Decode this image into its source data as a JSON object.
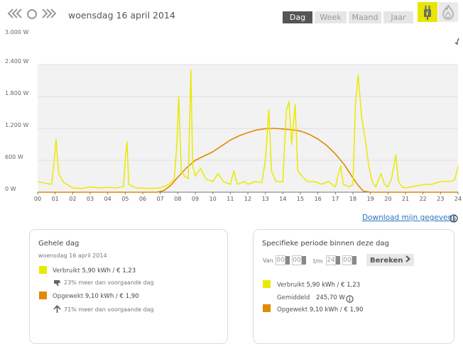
{
  "header": {
    "prev_label": "«",
    "today_label": "○",
    "next_label": "»",
    "date": "woensdag 16 april 2014",
    "tabs": [
      {
        "label": "Dag",
        "active": true
      },
      {
        "label": "Week",
        "active": false
      },
      {
        "label": "Maand",
        "active": false
      },
      {
        "label": "Jaar",
        "active": false
      }
    ],
    "energy_buttons": {
      "electricity_icon": "plug-icon",
      "gas_icon": "flame-icon"
    },
    "accent_color": "#e6e600"
  },
  "chart_data": {
    "type": "line",
    "x": [
      0,
      1,
      2,
      3,
      4,
      5,
      6,
      7,
      8,
      9,
      10,
      11,
      12,
      13,
      14,
      15,
      16,
      17,
      18,
      19,
      20,
      21,
      22,
      23,
      24
    ],
    "x_tick_labels": [
      "00",
      "01",
      "02",
      "03",
      "04",
      "05",
      "06",
      "07",
      "08",
      "09",
      "10",
      "11",
      "12",
      "13",
      "14",
      "15",
      "16",
      "17",
      "18",
      "19",
      "20",
      "21",
      "22",
      "23",
      "24"
    ],
    "y_tick_labels": [
      "0 W",
      "600 W",
      "1.200 W",
      "1.800 W",
      "2.400 W",
      "3.000 W"
    ],
    "ylim": [
      0,
      3000
    ],
    "xlim": [
      0,
      24
    ],
    "grid": true,
    "series": [
      {
        "color": "#e9e900",
        "values": [
          [
            0,
            200
          ],
          [
            0.4,
            170
          ],
          [
            0.8,
            150
          ],
          [
            0.95,
            600
          ],
          [
            1.05,
            1000
          ],
          [
            1.2,
            350
          ],
          [
            1.5,
            180
          ],
          [
            2,
            80
          ],
          [
            2.5,
            70
          ],
          [
            3,
            100
          ],
          [
            3.5,
            80
          ],
          [
            4,
            90
          ],
          [
            4.5,
            80
          ],
          [
            4.9,
            110
          ],
          [
            5,
            600
          ],
          [
            5.1,
            950
          ],
          [
            5.2,
            150
          ],
          [
            5.6,
            80
          ],
          [
            6,
            75
          ],
          [
            6.5,
            70
          ],
          [
            7,
            80
          ],
          [
            7.5,
            150
          ],
          [
            7.8,
            250
          ],
          [
            7.95,
            900
          ],
          [
            8.05,
            1800
          ],
          [
            8.2,
            400
          ],
          [
            8.4,
            300
          ],
          [
            8.6,
            250
          ],
          [
            8.75,
            2300
          ],
          [
            8.85,
            500
          ],
          [
            9,
            300
          ],
          [
            9.3,
            450
          ],
          [
            9.6,
            250
          ],
          [
            10,
            200
          ],
          [
            10.3,
            350
          ],
          [
            10.6,
            200
          ],
          [
            11,
            150
          ],
          [
            11.2,
            400
          ],
          [
            11.4,
            150
          ],
          [
            11.8,
            200
          ],
          [
            12,
            150
          ],
          [
            12.4,
            200
          ],
          [
            12.8,
            180
          ],
          [
            13,
            600
          ],
          [
            13.2,
            1550
          ],
          [
            13.35,
            400
          ],
          [
            13.6,
            200
          ],
          [
            14,
            200
          ],
          [
            14.2,
            1550
          ],
          [
            14.35,
            1700
          ],
          [
            14.5,
            900
          ],
          [
            14.7,
            1650
          ],
          [
            14.85,
            400
          ],
          [
            15.1,
            300
          ],
          [
            15.4,
            200
          ],
          [
            15.8,
            200
          ],
          [
            16.2,
            150
          ],
          [
            16.6,
            200
          ],
          [
            17,
            100
          ],
          [
            17.3,
            500
          ],
          [
            17.45,
            150
          ],
          [
            17.8,
            100
          ],
          [
            18,
            150
          ],
          [
            18.15,
            1700
          ],
          [
            18.3,
            2200
          ],
          [
            18.5,
            1400
          ],
          [
            18.7,
            1000
          ],
          [
            18.9,
            500
          ],
          [
            19.1,
            200
          ],
          [
            19.3,
            100
          ],
          [
            19.6,
            350
          ],
          [
            19.8,
            150
          ],
          [
            20,
            100
          ],
          [
            20.2,
            250
          ],
          [
            20.45,
            700
          ],
          [
            20.6,
            200
          ],
          [
            20.8,
            100
          ],
          [
            21,
            80
          ],
          [
            21.3,
            100
          ],
          [
            21.6,
            120
          ],
          [
            22,
            140
          ],
          [
            22.5,
            150
          ],
          [
            23,
            200
          ],
          [
            23.5,
            200
          ],
          [
            23.8,
            230
          ],
          [
            24,
            480
          ]
        ]
      },
      {
        "color": "#e08a00",
        "values": [
          [
            0,
            0
          ],
          [
            6.8,
            0
          ],
          [
            7.2,
            30
          ],
          [
            7.6,
            130
          ],
          [
            8,
            280
          ],
          [
            8.5,
            460
          ],
          [
            9,
            600
          ],
          [
            9.5,
            680
          ],
          [
            10,
            760
          ],
          [
            10.5,
            870
          ],
          [
            11,
            980
          ],
          [
            11.5,
            1060
          ],
          [
            12,
            1120
          ],
          [
            12.5,
            1170
          ],
          [
            13,
            1195
          ],
          [
            13.5,
            1200
          ],
          [
            14,
            1190
          ],
          [
            14.5,
            1175
          ],
          [
            15,
            1150
          ],
          [
            15.5,
            1090
          ],
          [
            16,
            1000
          ],
          [
            16.5,
            880
          ],
          [
            17,
            720
          ],
          [
            17.5,
            520
          ],
          [
            18,
            270
          ],
          [
            18.3,
            130
          ],
          [
            18.6,
            20
          ],
          [
            19,
            0
          ],
          [
            24,
            0
          ]
        ]
      }
    ]
  },
  "download_link": "Download mijn gegevens",
  "info_icon": "info-icon",
  "whole_day": {
    "title": "Gehele dag",
    "date": "woensdag 16 april 2014",
    "usage_label": "Verbruikt",
    "usage_value": "5,90 kWh",
    "usage_cost": "€ 1,23",
    "usage_compare": "23% meer dan voorgaande dag",
    "usage_compare_icon": "thumbs-down-icon",
    "gen_label": "Opgewekt",
    "gen_value": "9,10 kWh",
    "gen_cost": "€ 1,90",
    "gen_compare": "71% meer dan voorgaande dag",
    "gen_compare_icon": "arrow-up-icon",
    "sep": "/",
    "usage_color": "#e9e900",
    "gen_color": "#e08a00"
  },
  "period": {
    "title": "Specifieke periode binnen deze dag",
    "from_label": "Van",
    "from_hour": "00",
    "from_min": "00",
    "to_label": "t/m",
    "to_hour": "24",
    "to_min": "00",
    "calculate_label": "Bereken",
    "usage_label": "Verbruikt",
    "usage_value": "5,90 kWh",
    "usage_cost": "€ 1,23",
    "avg_label": "Gemiddeld",
    "avg_value": "245,70 W",
    "gen_label": "Opgewekt",
    "gen_value": "9,10 kWh",
    "gen_cost": "€ 1,90",
    "sep": "/"
  }
}
